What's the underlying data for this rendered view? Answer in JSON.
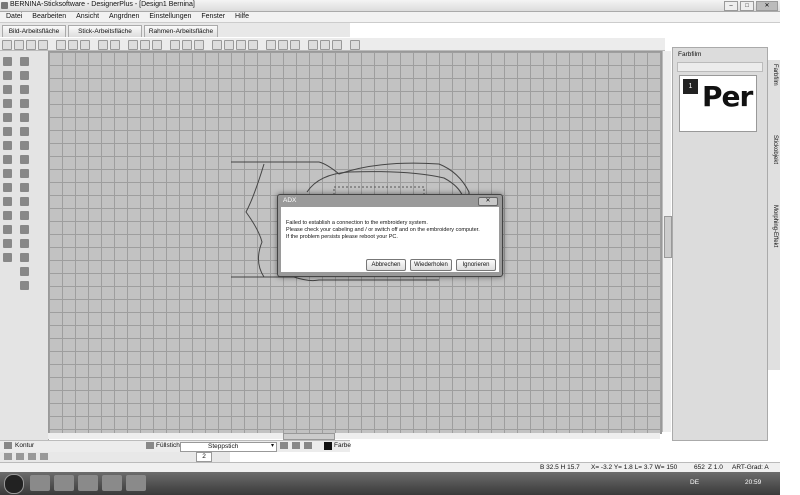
{
  "window": {
    "title": "BERNINA-Sticksoftware - DesignerPlus - [Design1      Bernina]"
  },
  "menu": [
    "Datei",
    "Bearbeiten",
    "Ansicht",
    "Angrdnen",
    "Einstellungen",
    "Fenster",
    "Hilfe"
  ],
  "tabs": [
    "Bild-Arbeitsfläche",
    "Stick-Arbeitsfläche",
    "Rahmen-Arbeitsfläche"
  ],
  "right_panel": {
    "title": "Farbfilm",
    "thumb_number": "1",
    "thumb_text": "Per"
  },
  "side_tabs": [
    "Farbfilm",
    "Stickobjekt",
    "Morphing-Effekt"
  ],
  "bottom": {
    "kontur": "Kontur",
    "fuellstich": "Füllstich",
    "steppstich": "Steppstich",
    "farbe": "Farbe",
    "zoom_value": "2"
  },
  "status": {
    "b": "B 32.5 H 15.7",
    "coords": "X= -3.2 Y= 1.8 L= 3.7 W= 150",
    "stitches": "652",
    "zoom": "Z 1.0",
    "art": "ART-Grad: A"
  },
  "taskbar": {
    "lang": "DE",
    "time": "20:59"
  },
  "dialog": {
    "title": "ADX",
    "lines": [
      "Failed to establish a connection to the embroidery system.",
      "Please check your cabeling and / or switch off and on the embroidery computer.",
      "If the problem persists please reboot your PC."
    ],
    "buttons": [
      "Abbrechen",
      "Wiederholen",
      "Ignorieren"
    ]
  }
}
